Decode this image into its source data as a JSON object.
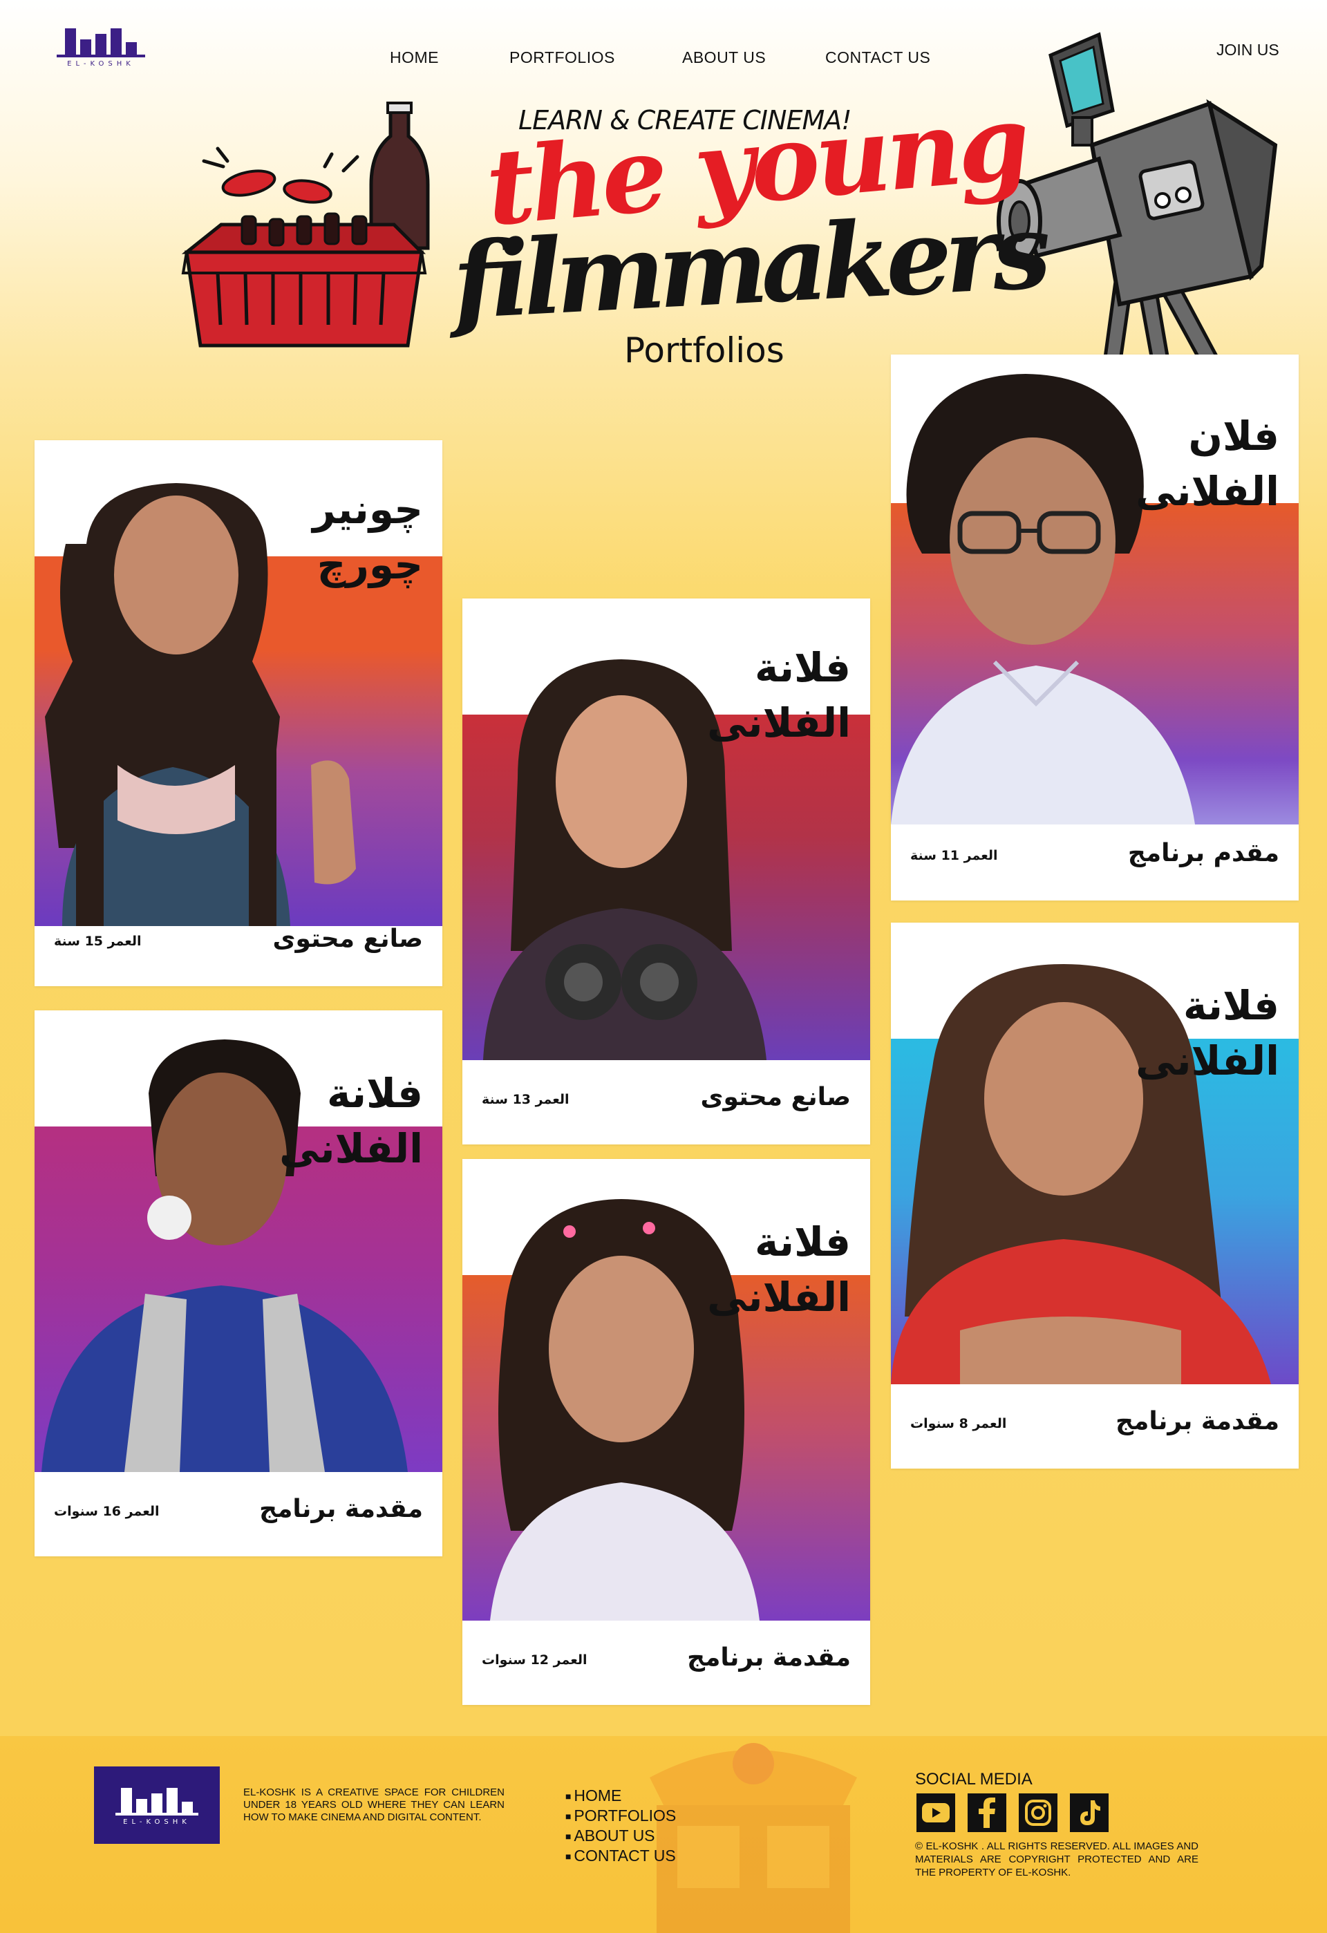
{
  "brand": {
    "logo_text": "EL-KOSHK"
  },
  "nav": {
    "home": "HOME",
    "portfolios": "PORTFOLIOS",
    "about": "ABOUT US",
    "contact": "CONTACT US",
    "join": "JOIN US"
  },
  "hero": {
    "tagline": "LEARN & CREATE CINEMA!",
    "title_line1": "the young",
    "title_line2": "filmmakers",
    "subtitle": "Portfolios"
  },
  "cards": [
    {
      "name_line1": "چونير",
      "name_line2": "چورچ",
      "role": "صانع محتوى",
      "age": "العمر 15 سنة",
      "band_color": "#e9592c",
      "band_color2": "#7b3bc0"
    },
    {
      "name_line1": "فلانة",
      "name_line2": "الفلانى",
      "role": "صانع محتوى",
      "age": "العمر 13 سنة",
      "band_color": "#c9303a",
      "band_color2": "#6a3fb8"
    },
    {
      "name_line1": "فلان",
      "name_line2": "الفلانى",
      "role": "مقدم برنامج",
      "age": "العمر 11 سنة",
      "band_color": "#e65a2a",
      "band_color2": "#7d4ac4"
    },
    {
      "name_line1": "فلانة",
      "name_line2": "الفلانى",
      "role": "مقدمة برنامج",
      "age": "العمر 16 سنوات",
      "band_color": "#b53081",
      "band_color2": "#7d3bc3"
    },
    {
      "name_line1": "فلانة",
      "name_line2": "الفلانى",
      "role": "مقدمة برنامج",
      "age": "العمر 12 سنوات",
      "band_color": "#e55d2b",
      "band_color2": "#7c3ec0"
    },
    {
      "name_line1": "فلانة",
      "name_line2": "الفلانى",
      "role": "مقدمة برنامج",
      "age": "العمر 8 سنوات",
      "band_color": "#2bbbe2",
      "band_color2": "#6d4ac8"
    }
  ],
  "footer": {
    "about": "EL-KOSHK IS A CREATIVE SPACE FOR CHILDREN UNDER 18 YEARS OLD WHERE THEY CAN LEARN HOW TO MAKE CINEMA AND DIGITAL CONTENT.",
    "links": [
      "HOME",
      "PORTFOLIOS",
      "ABOUT US",
      "CONTACT US"
    ],
    "social_title": "SOCIAL MEDIA",
    "social_icons": [
      "youtube-icon",
      "facebook-icon",
      "instagram-icon",
      "tiktok-icon"
    ],
    "copyright": "© EL-KOSHK . ALL RIGHTS RESERVED. ALL IMAGES AND MATERIALS ARE COPYRIGHT PROTECTED AND ARE THE PROPERTY OF EL-KOSHK."
  }
}
